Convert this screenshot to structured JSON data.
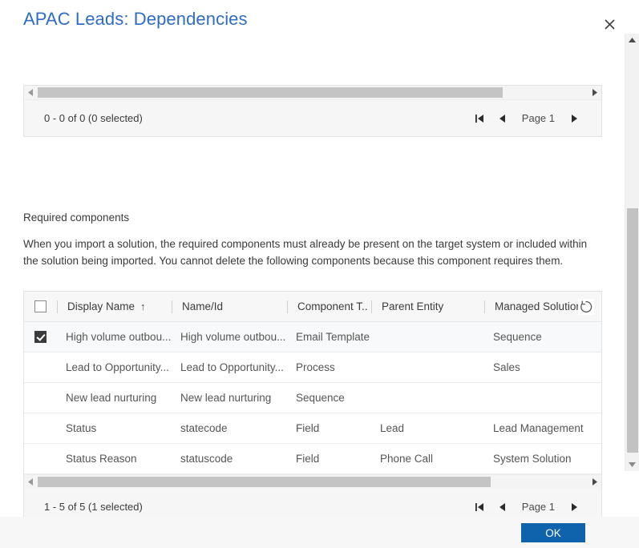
{
  "dialog": {
    "title": "APAC Leads: Dependencies",
    "close_label": "Close"
  },
  "top_grid": {
    "pager": {
      "status": "0 - 0 of 0 (0 selected)",
      "first_label": "First page",
      "prev_label": "Previous page",
      "page_label": "Page 1",
      "next_label": "Next page"
    }
  },
  "required_components": {
    "heading": "Required components",
    "description": "When you import a solution, the required components must already be present on the target system or included within the solution being imported. You cannot delete the following components because this component requires them."
  },
  "grid": {
    "select_all_checked": false,
    "columns": [
      {
        "key": "check",
        "label": ""
      },
      {
        "key": "display_name",
        "label": "Display Name",
        "sort": "↑"
      },
      {
        "key": "name_id",
        "label": "Name/Id"
      },
      {
        "key": "component_type",
        "label": "Component T.."
      },
      {
        "key": "parent_entity",
        "label": "Parent Entity"
      },
      {
        "key": "managed_solution",
        "label": "Managed Solution"
      }
    ],
    "rows": [
      {
        "selected": true,
        "display_name": "High volume outbou...",
        "name_id": "High volume outbou...",
        "component_type": "Email Template",
        "parent_entity": "",
        "managed_solution": "Sequence"
      },
      {
        "selected": false,
        "display_name": "Lead to Opportunity...",
        "name_id": "Lead to Opportunity...",
        "component_type": "Process",
        "parent_entity": "",
        "managed_solution": "Sales"
      },
      {
        "selected": false,
        "display_name": "New lead nurturing",
        "name_id": "New lead nurturing",
        "component_type": "Sequence",
        "parent_entity": "",
        "managed_solution": ""
      },
      {
        "selected": false,
        "display_name": "Status",
        "name_id": "statecode",
        "component_type": "Field",
        "parent_entity": "Lead",
        "managed_solution": "Lead Management"
      },
      {
        "selected": false,
        "display_name": "Status Reason",
        "name_id": "statuscode",
        "component_type": "Field",
        "parent_entity": "Phone Call",
        "managed_solution": "System Solution"
      }
    ],
    "pager": {
      "status": "1 - 5 of 5 (1 selected)",
      "first_label": "First page",
      "prev_label": "Previous page",
      "page_label": "Page 1",
      "next_label": "Next page"
    }
  },
  "footer": {
    "ok_label": "OK"
  },
  "colors": {
    "title": "#2f6cc4",
    "primary_button": "#0f62ac",
    "header_bg": "#f7f7f7",
    "scroll_thumb": "#c2c2c2"
  }
}
